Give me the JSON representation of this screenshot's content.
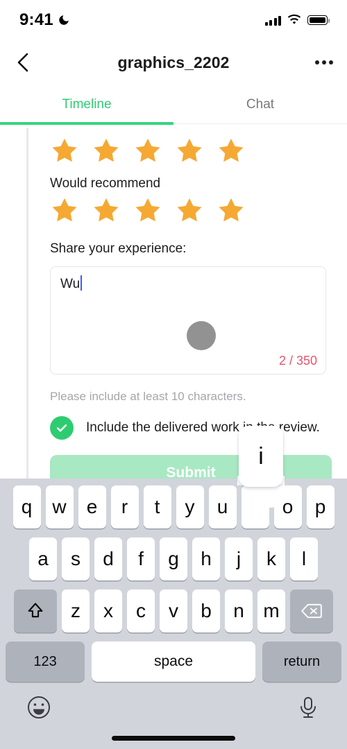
{
  "status_bar": {
    "time": "9:41",
    "moon_icon": "moon-icon",
    "signal_icon": "cellular-signal-icon",
    "wifi_icon": "wifi-icon",
    "battery_icon": "battery-full-icon"
  },
  "nav": {
    "back_icon": "chevron-left-icon",
    "title": "graphics_2202",
    "more_icon": "more-horizontal-icon"
  },
  "tabs": [
    {
      "label": "Timeline",
      "active": true
    },
    {
      "label": "Chat",
      "active": false
    }
  ],
  "review_form": {
    "rating_top": {
      "value": 5,
      "max": 5,
      "icon": "star-icon"
    },
    "recommend_label": "Would recommend",
    "rating_recommend": {
      "value": 5,
      "max": 5,
      "icon": "star-icon"
    },
    "experience_label": "Share your experience:",
    "textarea": {
      "value": "Wu",
      "char_count": "2 / 350",
      "count_color": "#e8536f"
    },
    "touch_indicator": "touch-point-indicator",
    "helper_text": "Please include at least 10 characters.",
    "checklist": {
      "icon": "check-circle-icon",
      "label": "Include the delivered work in the review.",
      "checked": true,
      "color": "#2ecc71"
    },
    "submit_label": "Submit",
    "submit_color": "#a8e8c3"
  },
  "keyboard": {
    "row1": [
      "q",
      "w",
      "e",
      "r",
      "t",
      "y",
      "u",
      "i",
      "o",
      "p"
    ],
    "row2": [
      "a",
      "s",
      "d",
      "f",
      "g",
      "h",
      "j",
      "k",
      "l"
    ],
    "row3": [
      "z",
      "x",
      "c",
      "v",
      "b",
      "n",
      "m"
    ],
    "shift_icon": "shift-up-arrow-icon",
    "backspace_icon": "backspace-delete-icon",
    "numbers_label": "123",
    "space_label": "space",
    "return_label": "return",
    "emoji_icon": "emoji-smiley-icon",
    "dictation_icon": "microphone-icon",
    "popup_key": "i"
  },
  "colors": {
    "accent_green": "#35d57f",
    "tab_active": "#2ecc71",
    "star": "#f5a933",
    "keyboard_bg": "#d1d5db",
    "caret": "#3b5bfd"
  }
}
